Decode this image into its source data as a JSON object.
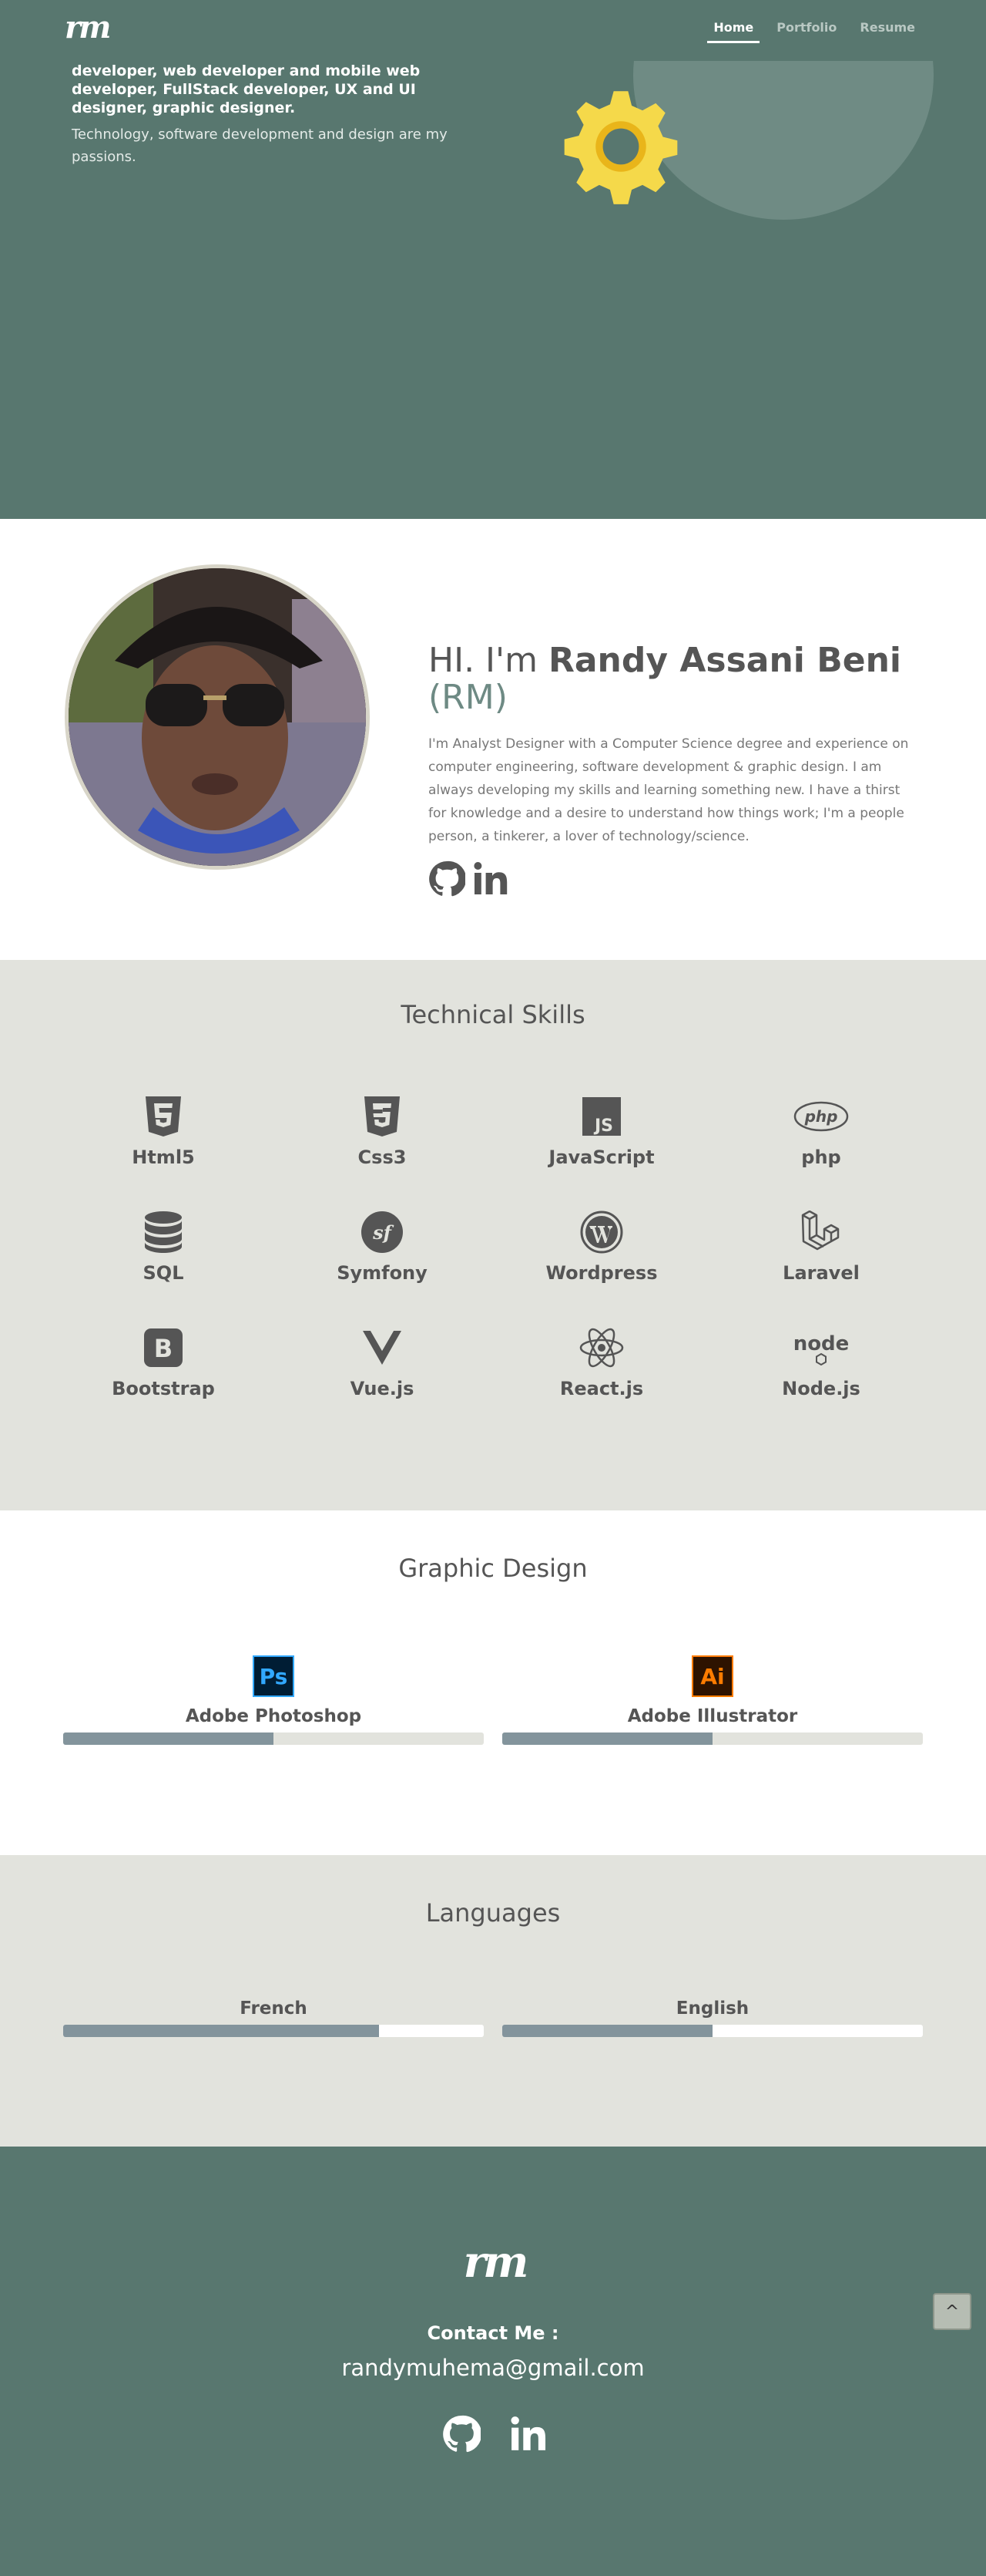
{
  "header": {
    "logo_text": "rm",
    "nav": [
      {
        "label": "Home",
        "active": true
      },
      {
        "label": "Portfolio",
        "active": false
      },
      {
        "label": "Resume",
        "active": false
      }
    ]
  },
  "hero": {
    "title": "developer, web developer and mobile web developer, FullStack developer, UX and UI designer, graphic designer.",
    "subtitle": "Technology, software development and design are my passions.",
    "gear_color": "#f5d94a"
  },
  "about": {
    "greeting_prefix": "HI. I'm ",
    "name": "Randy Assani Beni",
    "initials": "(RM)",
    "bio": "I'm Analyst Designer with a Computer Science degree and experience on computer engineering, software development & graphic design. I am always developing my skills and learning something new. I have a thirst for knowledge and a desire to understand how things work; I'm a people person, a tinkerer, a lover of technology/science.",
    "social_icons": [
      "github-icon",
      "linkedin-icon"
    ]
  },
  "skills": {
    "title": "Technical Skills",
    "items": [
      {
        "label": "Html5",
        "icon": "html5-icon"
      },
      {
        "label": "Css3",
        "icon": "css3-icon"
      },
      {
        "label": "JavaScript",
        "icon": "javascript-icon"
      },
      {
        "label": "php",
        "icon": "php-icon"
      },
      {
        "label": "SQL",
        "icon": "database-icon"
      },
      {
        "label": "Symfony",
        "icon": "symfony-icon"
      },
      {
        "label": "Wordpress",
        "icon": "wordpress-icon"
      },
      {
        "label": "Laravel",
        "icon": "laravel-icon"
      },
      {
        "label": "Bootstrap",
        "icon": "bootstrap-icon"
      },
      {
        "label": "Vue.js",
        "icon": "vuejs-icon"
      },
      {
        "label": "React.js",
        "icon": "react-icon"
      },
      {
        "label": "Node.js",
        "icon": "nodejs-icon"
      }
    ],
    "icon_glyphs": {
      "js": "JS",
      "php": "php",
      "bootstrap": "B",
      "symfony": "sf",
      "node": "node"
    }
  },
  "design": {
    "title": "Graphic Design",
    "tools": [
      {
        "label": "Adobe Photoshop",
        "badge": "Ps",
        "level": 0.5,
        "badge_bg": "#001d34",
        "badge_fg": "#31a8ff"
      },
      {
        "label": "Adobe Illustrator",
        "badge": "Ai",
        "level": 0.5,
        "badge_bg": "#2e1300",
        "badge_fg": "#ff7c00"
      }
    ],
    "track_color": "#e2e3dd"
  },
  "languages": {
    "title": "Languages",
    "items": [
      {
        "label": "French",
        "level": 0.75
      },
      {
        "label": "English",
        "level": 0.5
      }
    ],
    "track_color": "#ffffff"
  },
  "footer": {
    "logo_text": "rm",
    "contact_label": "Contact Me :",
    "email": "randymuhema@gmail.com"
  },
  "back_to_top": "^"
}
